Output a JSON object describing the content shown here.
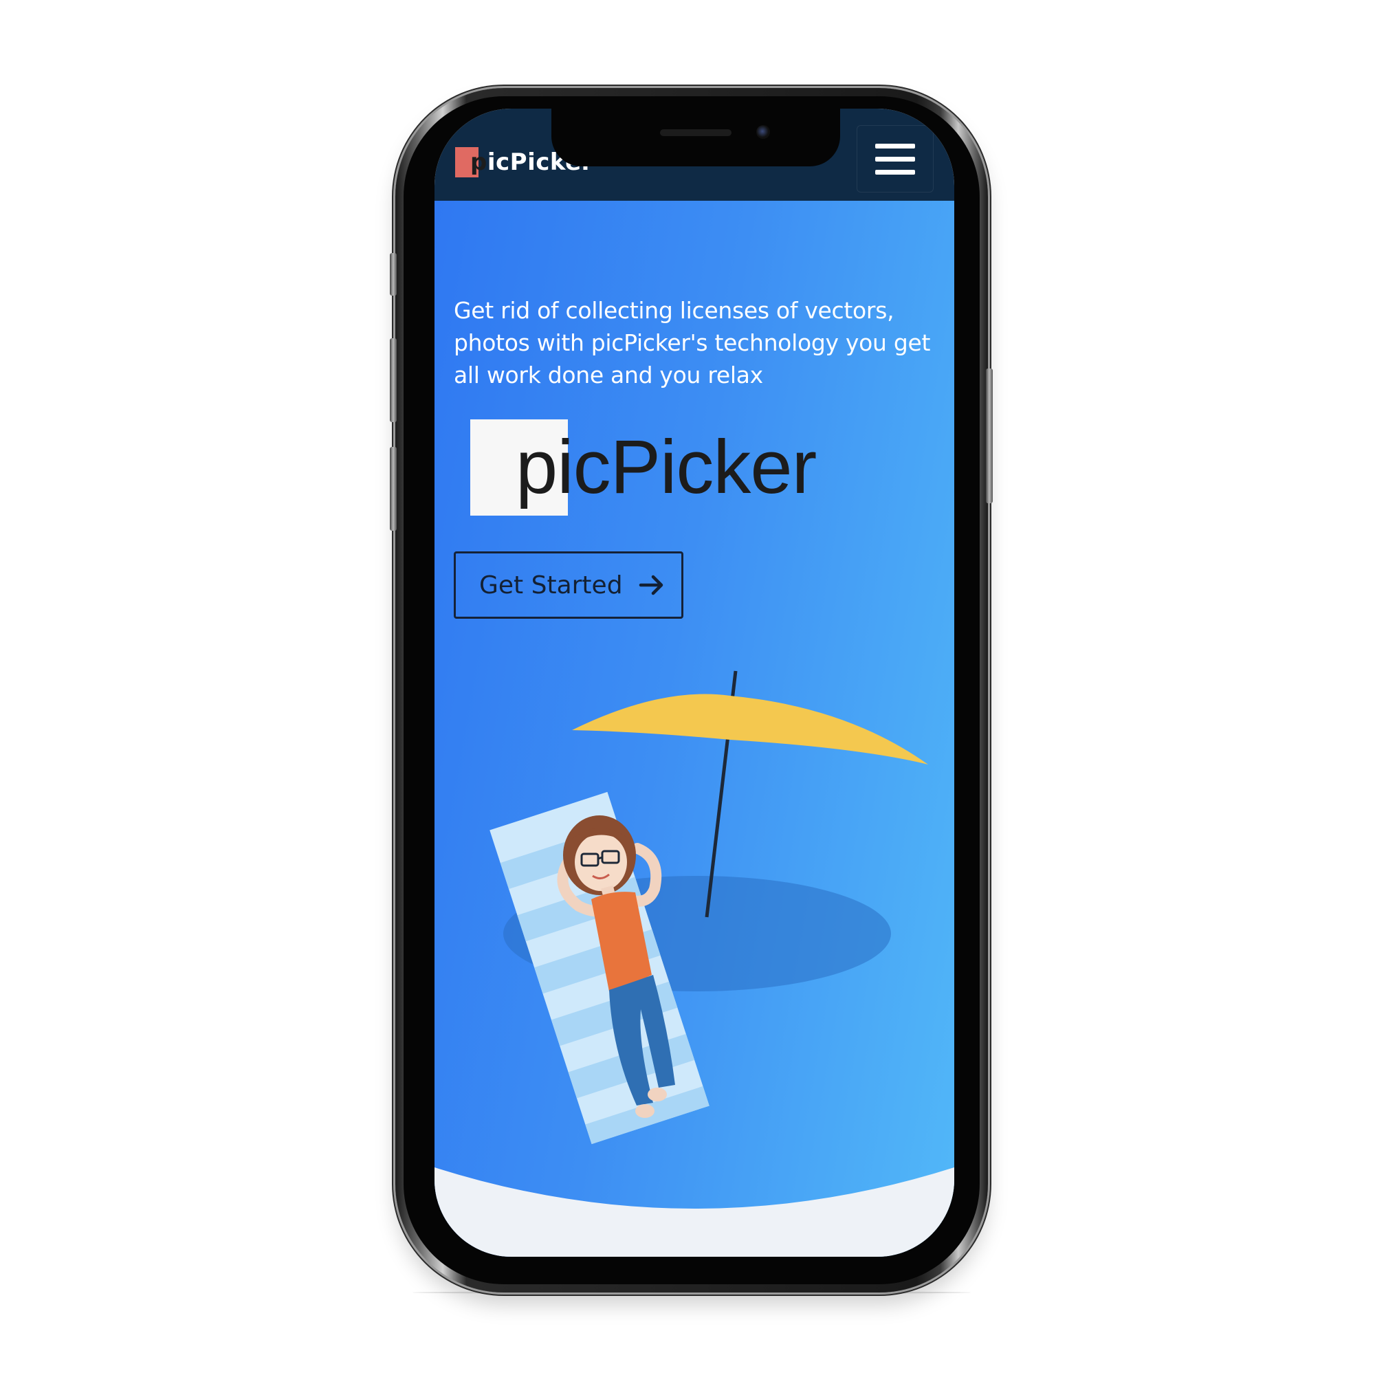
{
  "navbar": {
    "brand_first_letter": "p",
    "brand_rest": "icPicker",
    "menu_icon": "hamburger-menu-icon"
  },
  "hero": {
    "tagline": "Get rid of collecting licenses of vectors, photos with picPicker's technology you get all work done and you relax",
    "logo_first_letter": "p",
    "logo_rest": "icPicker",
    "cta_label": "Get Started",
    "cta_icon": "arrow-right-icon"
  },
  "colors": {
    "navbar_bg": "#0f2a45",
    "hero_gradient_start": "#2f78f2",
    "hero_gradient_end": "#52b8f8",
    "brand_accent": "#e06a62",
    "umbrella": "#f4c84f",
    "shirt": "#e8743c",
    "jeans": "#2f6fb3"
  }
}
